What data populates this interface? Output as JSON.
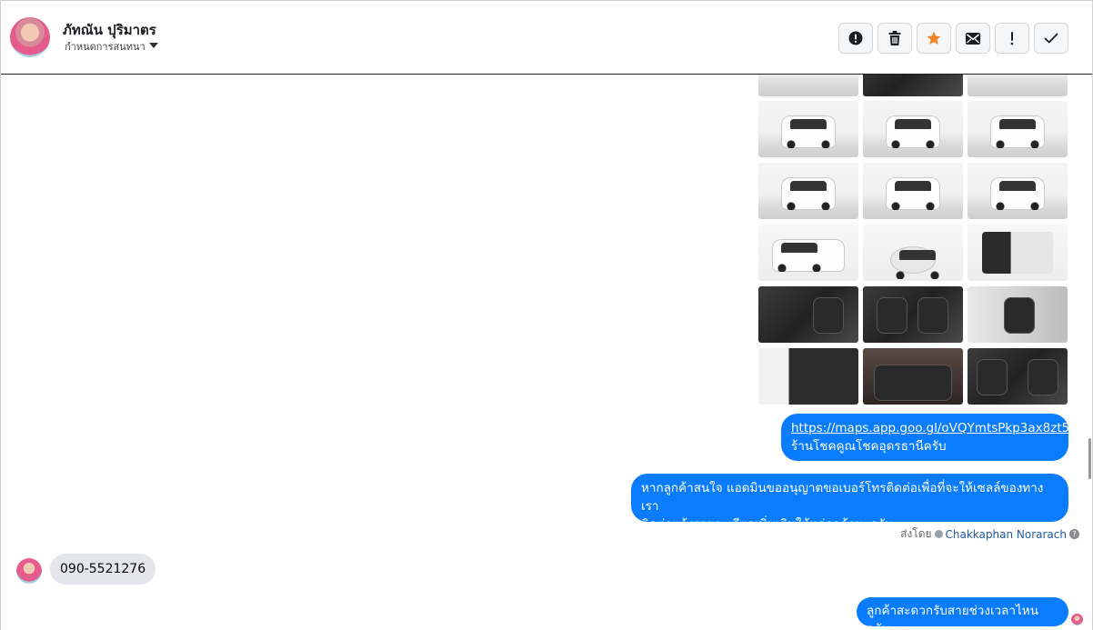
{
  "header": {
    "contact_name": "ภัทณัน ปุริมาตร",
    "label_select": "กำหนดการสนทนา"
  },
  "toolbar": {
    "buttons": [
      "spam-report",
      "delete",
      "star",
      "mark-unread",
      "important",
      "done"
    ],
    "star_color": "#f48024"
  },
  "thread": {
    "messages": [
      {
        "link": "https://maps.app.goo.gl/oVQYmtsPkp3ax8zt5",
        "text": "ร้านโชคคูณโชคอุดรธานีครับ"
      },
      {
        "line1": "หากลูกค้าสนใจ แอดมินขออนุญาตขอเบอร์โทรติดต่อเพื่อที่จะให้เซลล์ของทางเรา",
        "line2": "ติดต่อแจ้งรายละเอียดเพิ่มเติมให้แก่ลูกค้านะครับ"
      },
      {
        "text": "ลูกค้าสะดวกรับสายช่วงเวลาไหนครับ"
      }
    ],
    "sent_by_label": "ส่งโดย",
    "sent_by_name": "Chakkaphan Norarach",
    "incoming": "090-5521276"
  },
  "colors": {
    "outgoing_bubble": "#0a7cff",
    "incoming_bubble": "#e4e6eb"
  }
}
